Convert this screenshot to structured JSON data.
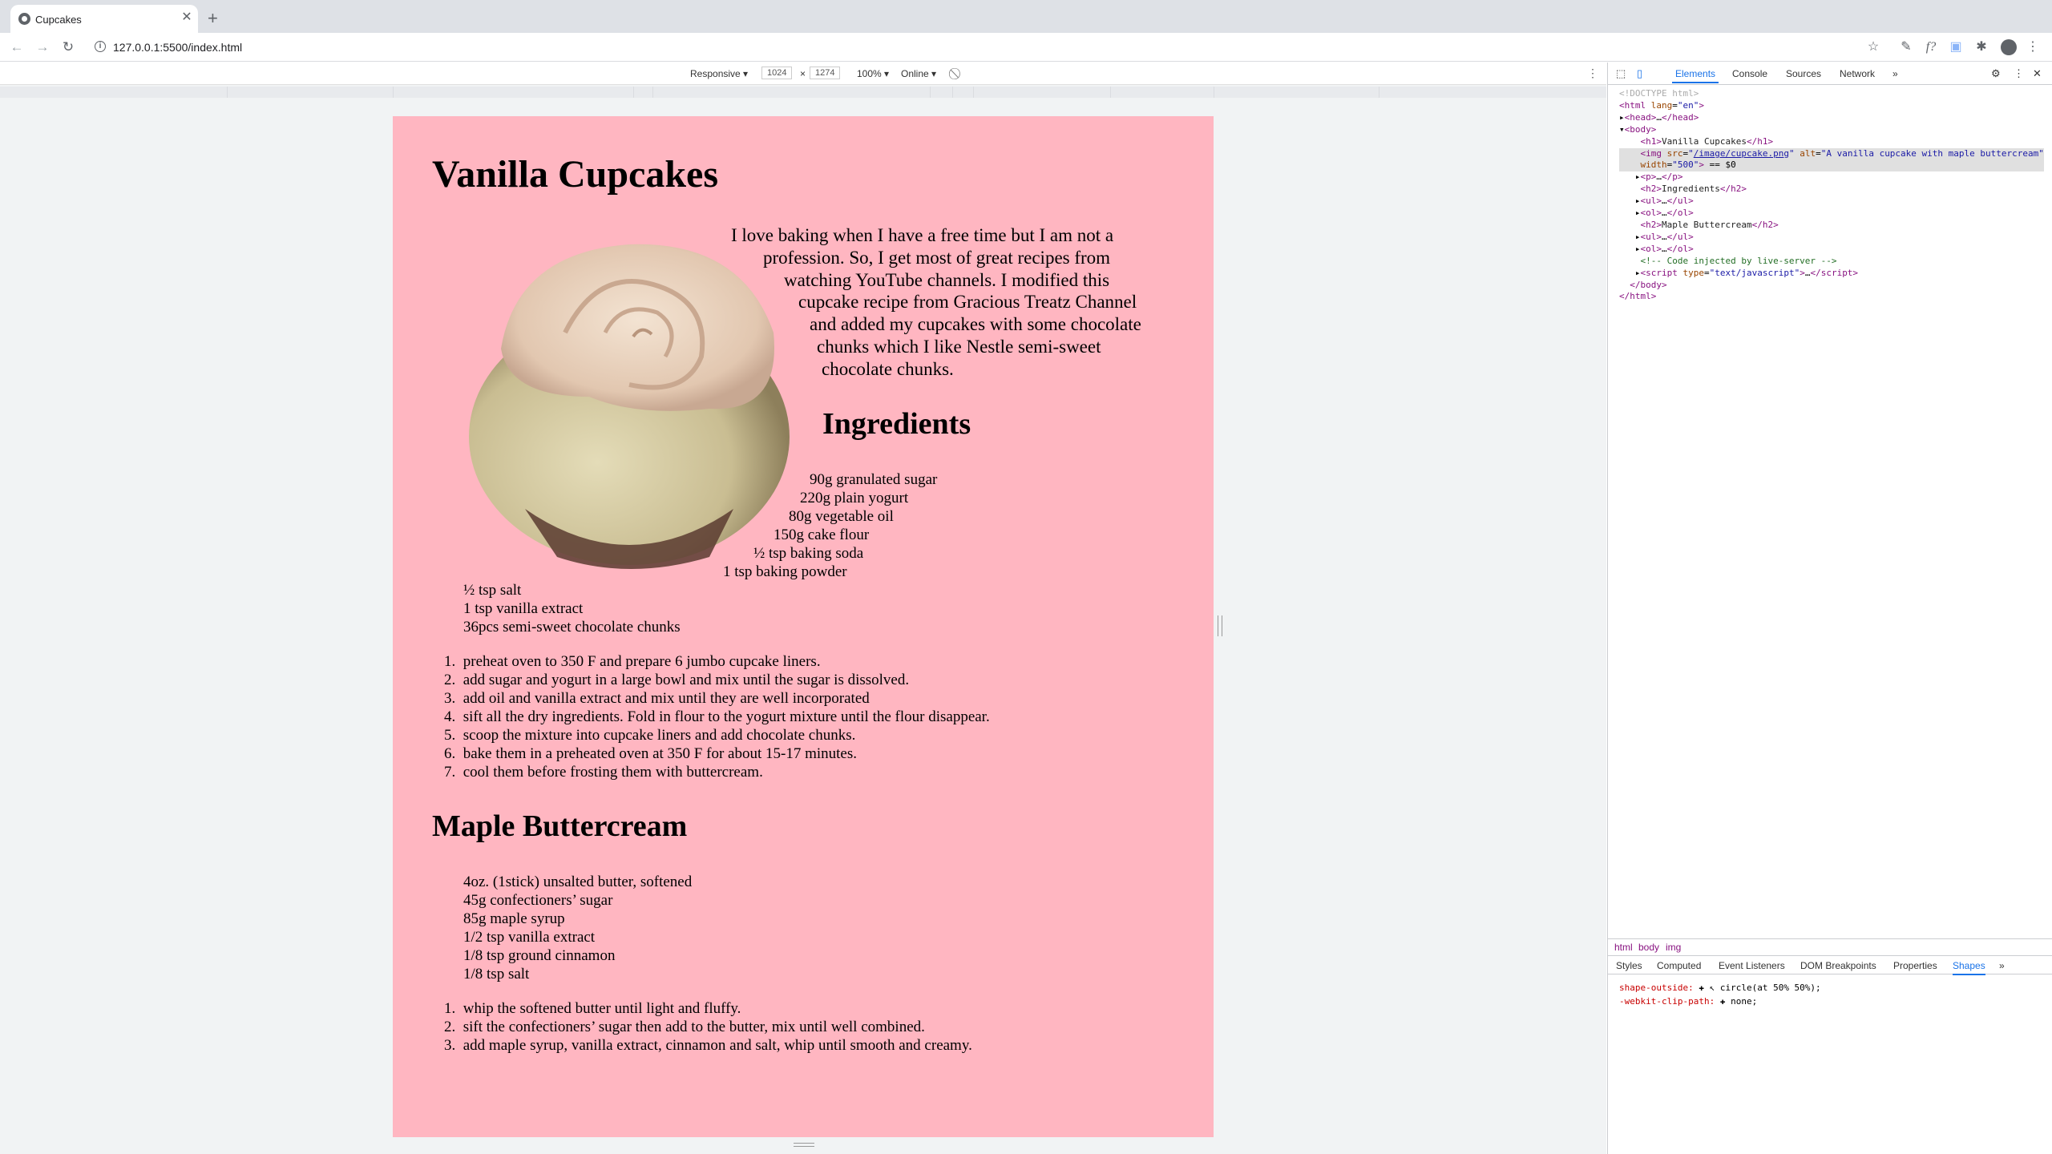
{
  "browser": {
    "tab_title": "Cupcakes",
    "tab_close": "✕",
    "new_tab": "+",
    "url": "127.0.0.1:5500/index.html",
    "info_icon": "i"
  },
  "device_toolbar": {
    "device": "Responsive ▾",
    "width": "1024",
    "times": "×",
    "height": "1274",
    "zoom": "100% ▾",
    "network": "Online ▾"
  },
  "page": {
    "h1": "Vanilla Cupcakes",
    "intro_lines": [
      "I love baking when I have a free time but I am not a",
      "profession. So, I get most of great recipes from",
      "watching YouTube channels. I modified this",
      "cupcake recipe from Gracious Treatz Channel",
      "and added my cupcakes with some chocolate",
      "chunks which I like Nestle semi-sweet",
      "chocolate chunks."
    ],
    "ingredients_heading": "Ingredients",
    "ingredients": [
      "90g granulated sugar",
      "220g plain yogurt",
      "80g vegetable oil",
      "150g cake flour",
      "½ tsp baking soda",
      "1 tsp baking powder",
      "½ tsp salt",
      "1 tsp vanilla extract",
      "36pcs semi-sweet chocolate chunks"
    ],
    "steps": [
      "preheat oven to 350 F and prepare 6 jumbo cupcake liners.",
      "add sugar and yogurt in a large bowl and mix until the sugar is dissolved.",
      "add oil and vanilla extract and mix until they are well incorporated",
      "sift all the dry ingredients. Fold in flour to the yogurt mixture until the flour disappear.",
      "scoop the mixture into cupcake liners and add chocolate chunks.",
      "bake them in a preheated oven at 350 F for about 15-17 minutes.",
      "cool them before frosting them with buttercream."
    ],
    "buttercream_heading": "Maple Buttercream",
    "buttercream_ingredients": [
      "4oz. (1stick) unsalted butter, softened",
      "45g confectioners’ sugar",
      "85g maple syrup",
      "1/2 tsp vanilla extract",
      "1/8 tsp ground cinnamon",
      "1/8 tsp salt"
    ],
    "buttercream_steps": [
      "whip the softened butter until light and fluffy.",
      "sift the confectioners’ sugar then add to the butter, mix until well combined.",
      "add maple syrup, vanilla extract, cinnamon and salt, whip until smooth and creamy."
    ]
  },
  "devtools": {
    "tabs": [
      "Elements",
      "Console",
      "Sources",
      "Network",
      "»"
    ],
    "crumbs": [
      "html",
      "body",
      "img"
    ],
    "subtabs": [
      "Styles",
      "Computed",
      "Event Listeners",
      "DOM Breakpoints",
      "Properties",
      "Shapes",
      "»"
    ],
    "shape_outside_prop": "shape-outside:",
    "shape_outside_val": "circle(at 50% 50%);",
    "clip_path_prop": "-webkit-clip-path:",
    "clip_path_val": "none;"
  },
  "colors": {
    "page_bg": "#ffb6c1",
    "accent": "#1a73e8"
  }
}
